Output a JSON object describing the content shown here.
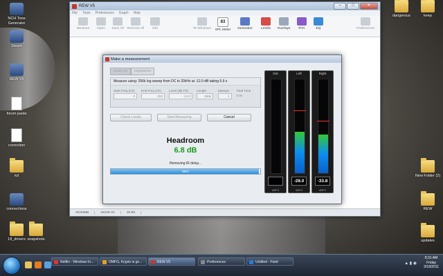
{
  "desktop": {
    "left_icons": [
      {
        "label": "NCH Tone Generator",
        "kind": "app"
      },
      {
        "label": "Steam",
        "kind": "app"
      },
      {
        "label": "REW V5",
        "kind": "app"
      },
      {
        "label": "forum paste",
        "kind": "doc"
      },
      {
        "label": "correction",
        "kind": "doc"
      },
      {
        "label": "kd",
        "kind": "folder"
      },
      {
        "label": "connections",
        "kind": "app"
      },
      {
        "label": "18_drivers",
        "kind": "folder"
      },
      {
        "label": "snapshots",
        "kind": "folder"
      }
    ],
    "right_icons": [
      {
        "label": "dangerous",
        "kind": "folder"
      },
      {
        "label": "keep",
        "kind": "folder"
      },
      {
        "label": "New Folder (2)",
        "kind": "folder"
      },
      {
        "label": "REW",
        "kind": "folder"
      },
      {
        "label": "updates",
        "kind": "folder"
      }
    ]
  },
  "rew": {
    "title": "REW V5",
    "menu": [
      "File",
      "Tools",
      "Preferences",
      "Graph",
      "Help"
    ],
    "toolbar": [
      {
        "label": "Measure",
        "icon": "microphone-icon"
      },
      {
        "label": "Open",
        "icon": "folder-open-icon"
      },
      {
        "label": "Save All",
        "icon": "save-icon"
      },
      {
        "label": "Remove All",
        "icon": "trash-icon"
      },
      {
        "label": "Info",
        "icon": "info-icon"
      },
      {
        "label": "IR Windows",
        "icon": "ir-windows-icon"
      },
      {
        "label": "SPL Meter",
        "icon": "spl-meter-icon",
        "value": "83"
      },
      {
        "label": "Generator",
        "icon": "generator-icon"
      },
      {
        "label": "Levels",
        "icon": "levels-icon"
      },
      {
        "label": "Overlays",
        "icon": "overlays-icon"
      },
      {
        "label": "RTA",
        "icon": "rta-icon"
      },
      {
        "label": "EQ",
        "icon": "eq-icon"
      },
      {
        "label": "Preferences",
        "icon": "wrench-icon"
      }
    ],
    "status": [
      "20/33MB",
      "44100 Hz",
      "16 Bit"
    ]
  },
  "dialog": {
    "title": "Make a measurement",
    "tabs": [
      "Level Cal",
      "Impedance"
    ],
    "panel_heading": "Measure using: 256k log sweep from DC to 20kHz at -12.0 dB taking 5.9 s",
    "fields": [
      {
        "label": "Start Freq (Hz)",
        "value": "0"
      },
      {
        "label": "End Freq (Hz)",
        "value": "200"
      },
      {
        "label": "Level (dB FS)",
        "value": "-12.0"
      },
      {
        "label": "Length",
        "value": "256k"
      },
      {
        "label": "Sweeps",
        "value": "1"
      },
      {
        "label": "Total Time",
        "value": "5.9s"
      }
    ],
    "buttons": {
      "check_levels": "Check Levels",
      "start_measuring": "Start Measuring",
      "cancel": "Cancel"
    },
    "headroom_title": "Headroom",
    "headroom_value": "6.8 dB",
    "status_message": "Removing IR delay...",
    "progress": {
      "percent": 99,
      "label": "99%"
    },
    "meters": [
      {
        "name": "Out",
        "readout": "",
        "unit": "dBFS",
        "level": 0.0,
        "peak": null
      },
      {
        "name": "Left",
        "readout": "-28.0",
        "unit": "dBFS",
        "level": 0.44,
        "peak": 0.66
      },
      {
        "name": "Right",
        "readout": "-33.8",
        "unit": "dBFS",
        "level": 0.41,
        "peak": 0.55
      }
    ]
  },
  "taskbar": {
    "tasks": [
      {
        "label": "Netflix - Windows In...",
        "active": false,
        "color": "#d33"
      },
      {
        "label": "OMFG, Krypto is ge...",
        "active": false,
        "color": "#e8a020"
      },
      {
        "label": "REW V5",
        "active": true,
        "color": "#c0392b"
      },
      {
        "label": "Preferences",
        "active": false,
        "color": "#888"
      },
      {
        "label": "Untitled - Paint",
        "active": false,
        "color": "#2a7ad8"
      }
    ],
    "time": "8:31 AM",
    "day": "Friday",
    "date": "3/18/2011"
  },
  "colors": {
    "headroom_green": "#1b9b1b",
    "progress_blue": "#2f8fd8",
    "meter_peak_red": "#e33"
  }
}
